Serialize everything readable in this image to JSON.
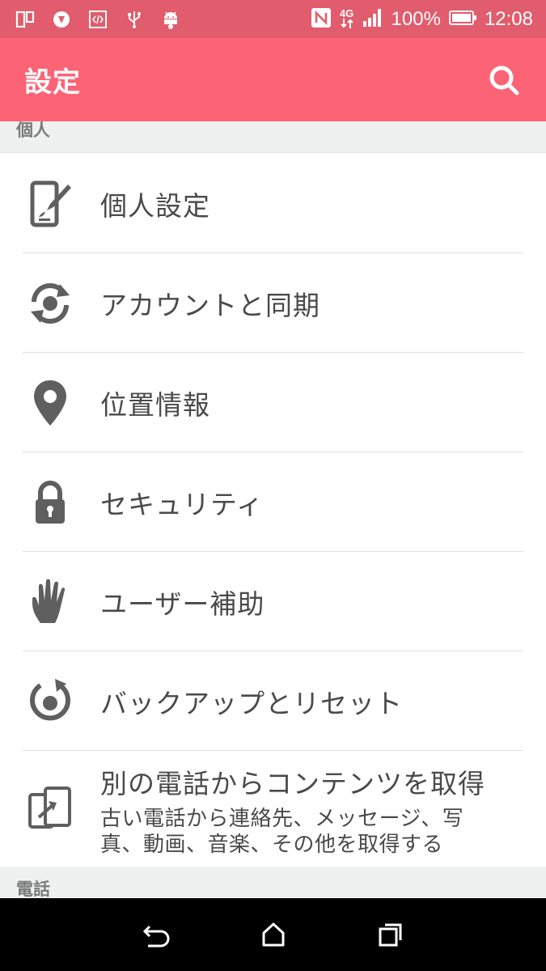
{
  "status_bar": {
    "battery_percent": "100%",
    "time": "12:08",
    "network": "4G",
    "left_icons": [
      "multi-window-icon",
      "shield-icon",
      "code-icon",
      "usb-icon",
      "android-icon"
    ],
    "right_icons": [
      "nfc-icon",
      "4g-data-icon",
      "signal-icon",
      "battery-icon"
    ]
  },
  "app_bar": {
    "title": "設定",
    "search_icon": "search-icon"
  },
  "sections": {
    "personal": "個人",
    "phone": "電話"
  },
  "items": [
    {
      "label": "個人設定",
      "icon": "personalize-icon"
    },
    {
      "label": "アカウントと同期",
      "icon": "sync-icon"
    },
    {
      "label": "位置情報",
      "icon": "location-pin-icon"
    },
    {
      "label": "セキュリティ",
      "icon": "lock-icon"
    },
    {
      "label": "ユーザー補助",
      "icon": "hand-icon"
    },
    {
      "label": "バックアップとリセット",
      "icon": "backup-icon"
    },
    {
      "label": "別の電話からコンテンツを取得",
      "sublabel": "古い電話から連絡先、メッセージ、写真、動画、音楽、その他を取得する",
      "icon": "phone-transfer-icon"
    }
  ],
  "colors": {
    "status_bar": "#e15c6c",
    "app_bar": "#fc6476",
    "section_bg": "#eff1f1",
    "icon_gray": "#5f5f5f"
  }
}
